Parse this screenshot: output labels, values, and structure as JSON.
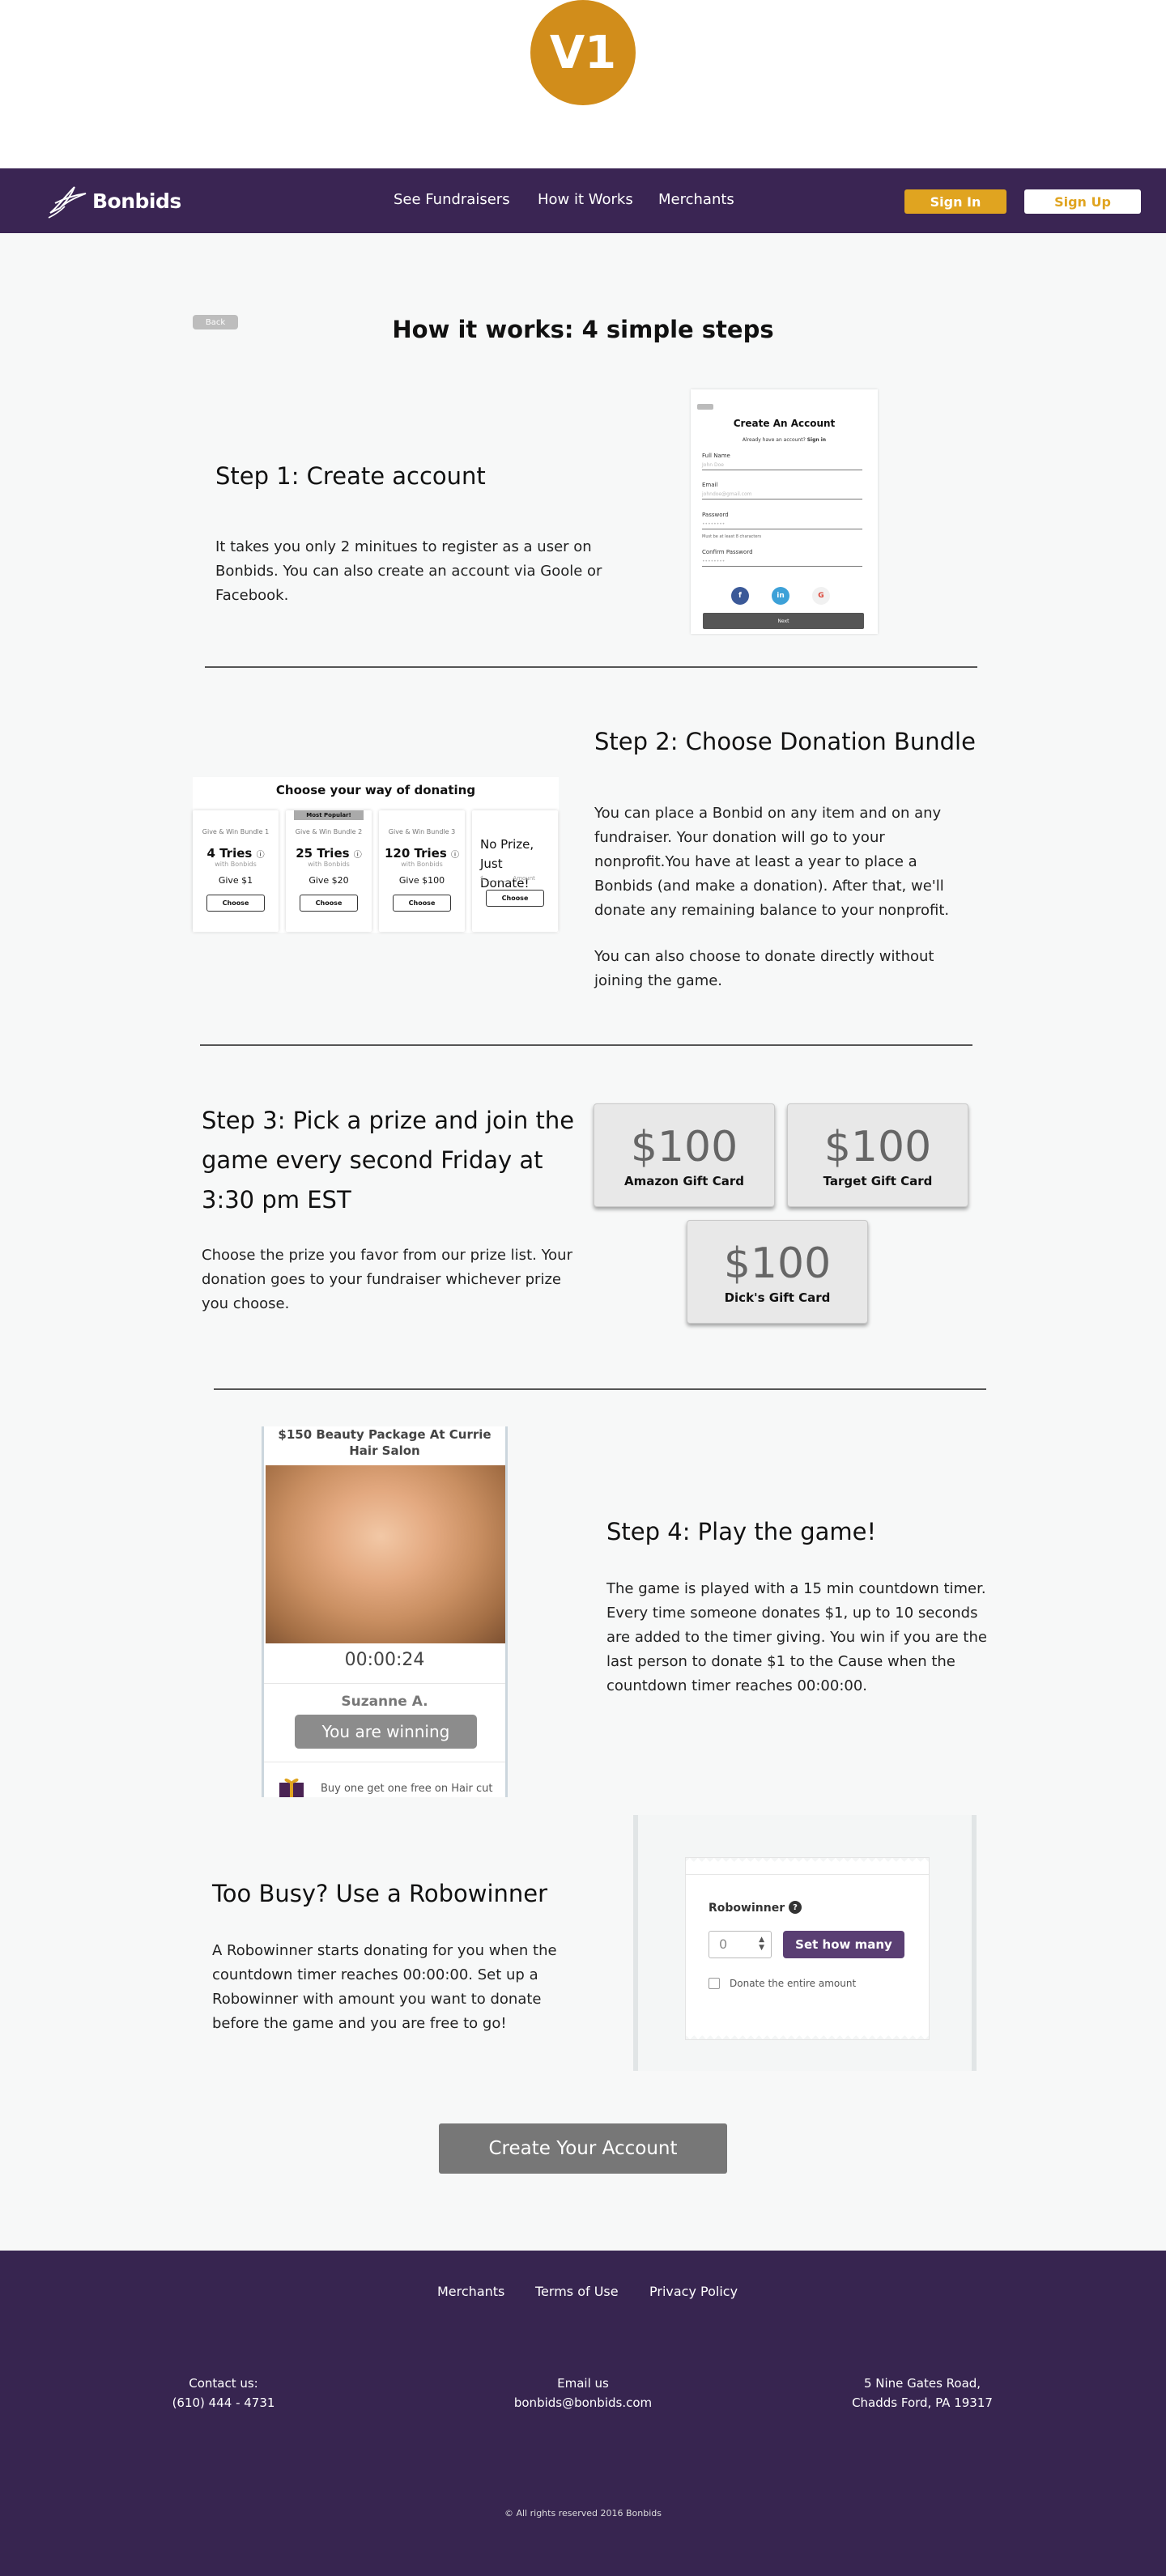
{
  "version_badge": "V1",
  "nav": {
    "brand": "Bonbids",
    "links": [
      "See Fundraisers",
      "How it Works",
      "Merchants"
    ],
    "sign_in": "Sign In",
    "sign_up": "Sign Up"
  },
  "back_label": "Back",
  "page_title": "How it works:  4 simple steps",
  "step1": {
    "title": "Step 1: Create account",
    "body": "It takes you only 2 minitues to register as a user on Bonbids. You can also create an account via Goole or Facebook.",
    "mock": {
      "title": "Create An Account",
      "subtitle": "Already have an account?",
      "sign_in_link": "Sign in",
      "fields": [
        {
          "label": "Full Name",
          "placeholder": "John Doe"
        },
        {
          "label": "Email",
          "placeholder": "johndoe@gmail.com"
        },
        {
          "label": "Password",
          "placeholder": "••••••••"
        },
        {
          "label": "Confirm Password",
          "placeholder": "••••••••"
        }
      ],
      "password_hint": "Must be at least 8 characters",
      "social": [
        "f",
        "in",
        "G"
      ],
      "next": "Next"
    }
  },
  "step2": {
    "title": "Step 2: Choose Donation Bundle",
    "body1": "You can place a Bonbid on any item and on any fundraiser. Your donation will go to your nonprofit.You have at least a  year to place a Bonbids (and make a donation). After that, we'll donate any remaining balance to your nonprofit.",
    "body2": "You can also choose to donate directly without joining the game.",
    "mock": {
      "title": "Choose your way of donating",
      "bundles": [
        {
          "name": "Give & Win Bundle 1",
          "tries": "4 Tries",
          "with": "with Bonbids",
          "give": "Give $1",
          "choose": "Choose"
        },
        {
          "name": "Give & Win Bundle 2",
          "tries": "25 Tries",
          "with": "with Bonbids",
          "give": "Give $20",
          "choose": "Choose",
          "badge": "Most Popular!"
        },
        {
          "name": "Give & Win Bundle 3",
          "tries": "120 Tries",
          "with": "with Bonbids",
          "give": "Give $100",
          "choose": "Choose"
        }
      ],
      "no_prize": "No Prize, Just Donate!",
      "amount_placeholder": "$ _________ Amount",
      "no_prize_choose": "Choose"
    }
  },
  "step3": {
    "title": "Step 3: Pick a prize and join the game every second Friday at 3:30 pm EST",
    "body": "Choose the prize you favor from our prize list. Your donation goes to your fundraiser whichever prize you choose.",
    "prizes": [
      {
        "amount": "$100",
        "name": "Amazon Gift Card"
      },
      {
        "amount": "$100",
        "name": "Target Gift Card"
      },
      {
        "amount": "$100",
        "name": "Dick's Gift Card"
      }
    ]
  },
  "step4": {
    "title": "Step 4: Play the game!",
    "body": "The game is played with a 15 min countdown timer. Every time someone donates $1, up to 10 seconds are added to the timer giving. You win if you are the last person to donate $1 to the Cause when the countdown timer reaches 00:00:00.",
    "mock": {
      "item_title": "$150 Beauty Package At Currie Hair Salon",
      "timer": "00:00:24",
      "user": "Suzanne A.",
      "status": "You are winning",
      "promo": "Buy one get one free on Hair cut"
    }
  },
  "step5": {
    "title": "Too Busy? Use a Robowinner",
    "body": "A Robowinner starts donating for you when the countdown timer reaches 00:00:00. Set up a Robowinner with amount you want to donate before the game and you are free to go!",
    "mock": {
      "label": "Robowinner",
      "help": "?",
      "value": "0",
      "button": "Set how many",
      "checkbox_label": "Donate the entire amount"
    }
  },
  "cta": "Create Your Account",
  "footer": {
    "links": [
      "Merchants",
      "Terms of Use",
      "Privacy Policy"
    ],
    "contact_label": "Contact us:",
    "phone": "(610) 444 - 4731",
    "email_label": "Email us",
    "email": "bonbids@bonbids.com",
    "address1": "5 Nine Gates Road,",
    "address2": "Chadds Ford, PA 19317",
    "copyright": "© All rights reserved 2016 Bonbids"
  },
  "colors": {
    "brand_purple": "#3a2553",
    "accent_gold": "#e0a420",
    "badge_gold": "#d18d1b"
  }
}
